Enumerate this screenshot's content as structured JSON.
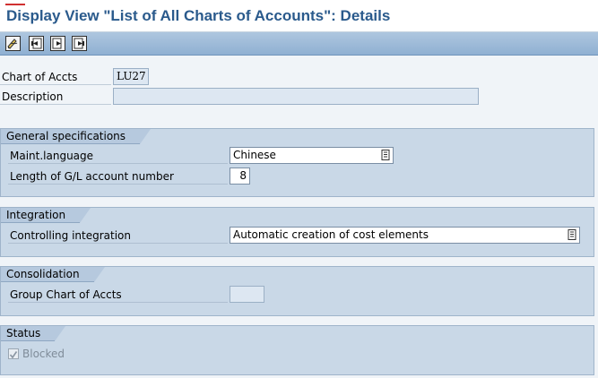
{
  "title": "Display View \"List of All Charts of Accounts\": Details",
  "toolbar": {
    "buttons": [
      {
        "name": "edit-toggle-icon"
      },
      {
        "name": "first-entry-icon"
      },
      {
        "name": "next-entry-icon"
      },
      {
        "name": "last-entry-icon"
      }
    ]
  },
  "header_fields": {
    "chart_label": "Chart of Accts",
    "chart_value": "LU27",
    "description_label": "Description",
    "description_value": ""
  },
  "general": {
    "title": "General specifications",
    "language_label": "Maint.language",
    "language_value": "Chinese",
    "length_label": "Length of G/L account number",
    "length_value": "8"
  },
  "integration": {
    "title": "Integration",
    "controlling_label": "Controlling integration",
    "controlling_value": "Automatic creation of cost elements"
  },
  "consolidation": {
    "title": "Consolidation",
    "group_chart_label": "Group Chart of Accts",
    "group_chart_value": ""
  },
  "status": {
    "title": "Status",
    "blocked_label": "Blocked",
    "blocked_checked": true
  },
  "colors": {
    "title": "#2a5a8c",
    "toolbar": "#9bbad8",
    "group_bg": "#c9d8e7"
  }
}
